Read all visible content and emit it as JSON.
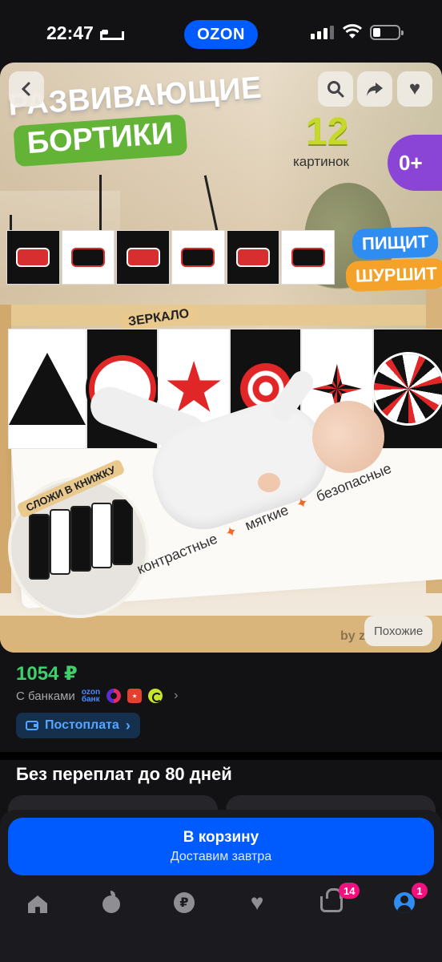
{
  "status_bar": {
    "time": "22:47",
    "brand": "OZON"
  },
  "product_image": {
    "headline_line1": "РАЗВИВАЮЩИЕ",
    "headline_line2": "БОРТИКИ",
    "count_number": "12",
    "count_label": "картинок",
    "age_badge": "0+",
    "feature_pill_1": "ПИЩИТ",
    "feature_pill_2": "ШУРШИТ",
    "mirror_label": "ЗЕРКАЛО",
    "book_label": "СЛОЖИ В КНИЖКУ",
    "features": [
      "контрастные",
      "мягкие",
      "безопасные"
    ],
    "watermark": "by z",
    "similar_button": "Похожие"
  },
  "price_block": {
    "price": "1054 ₽",
    "with_banks_label": "С банками",
    "bank_ozon_line1": "ozon",
    "bank_ozon_line2": "банк",
    "postpay_label": "Постоплата"
  },
  "installments": {
    "title": "Без переплат до 80 дней"
  },
  "cart": {
    "label": "В корзину",
    "sublabel": "Доставим завтра"
  },
  "bottom_nav": {
    "cart_badge": "14",
    "profile_badge": "1"
  },
  "colors": {
    "accent": "#005bff",
    "price": "#3fd06c",
    "badge": "#f1117e"
  }
}
